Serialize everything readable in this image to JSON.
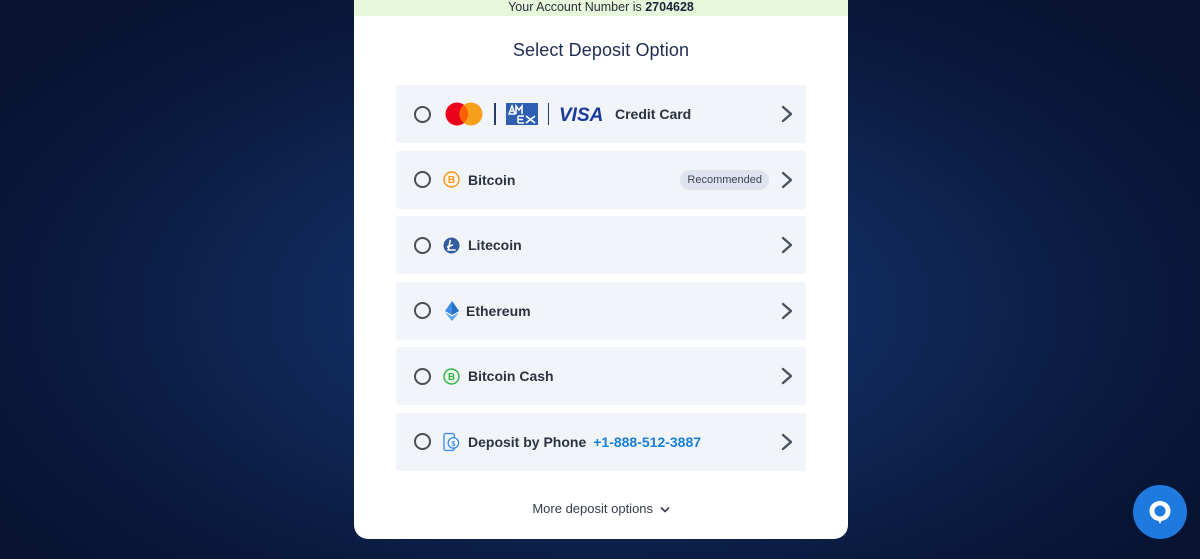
{
  "account": {
    "prefix": "Your Account Number is",
    "number": "2704628"
  },
  "title": "Select Deposit Option",
  "options": [
    {
      "label": "Credit Card",
      "icon": "credit-card-logos"
    },
    {
      "label": "Bitcoin",
      "icon": "bitcoin-icon",
      "badge": "Recommended"
    },
    {
      "label": "Litecoin",
      "icon": "litecoin-icon"
    },
    {
      "label": "Ethereum",
      "icon": "ethereum-icon"
    },
    {
      "label": "Bitcoin Cash",
      "icon": "bitcoin-cash-icon"
    },
    {
      "label": "Deposit by Phone",
      "icon": "phone-deposit-icon",
      "phone": "+1-888-512-3887"
    }
  ],
  "more_options": "More deposit options",
  "colors": {
    "accent": "#1f7ae0",
    "phone_link": "#1a7fd8",
    "bitcoin": "#f7931a",
    "litecoin": "#345d9d",
    "ethereum": "#3c8ce7",
    "bitcoin_cash": "#2fb34a"
  }
}
